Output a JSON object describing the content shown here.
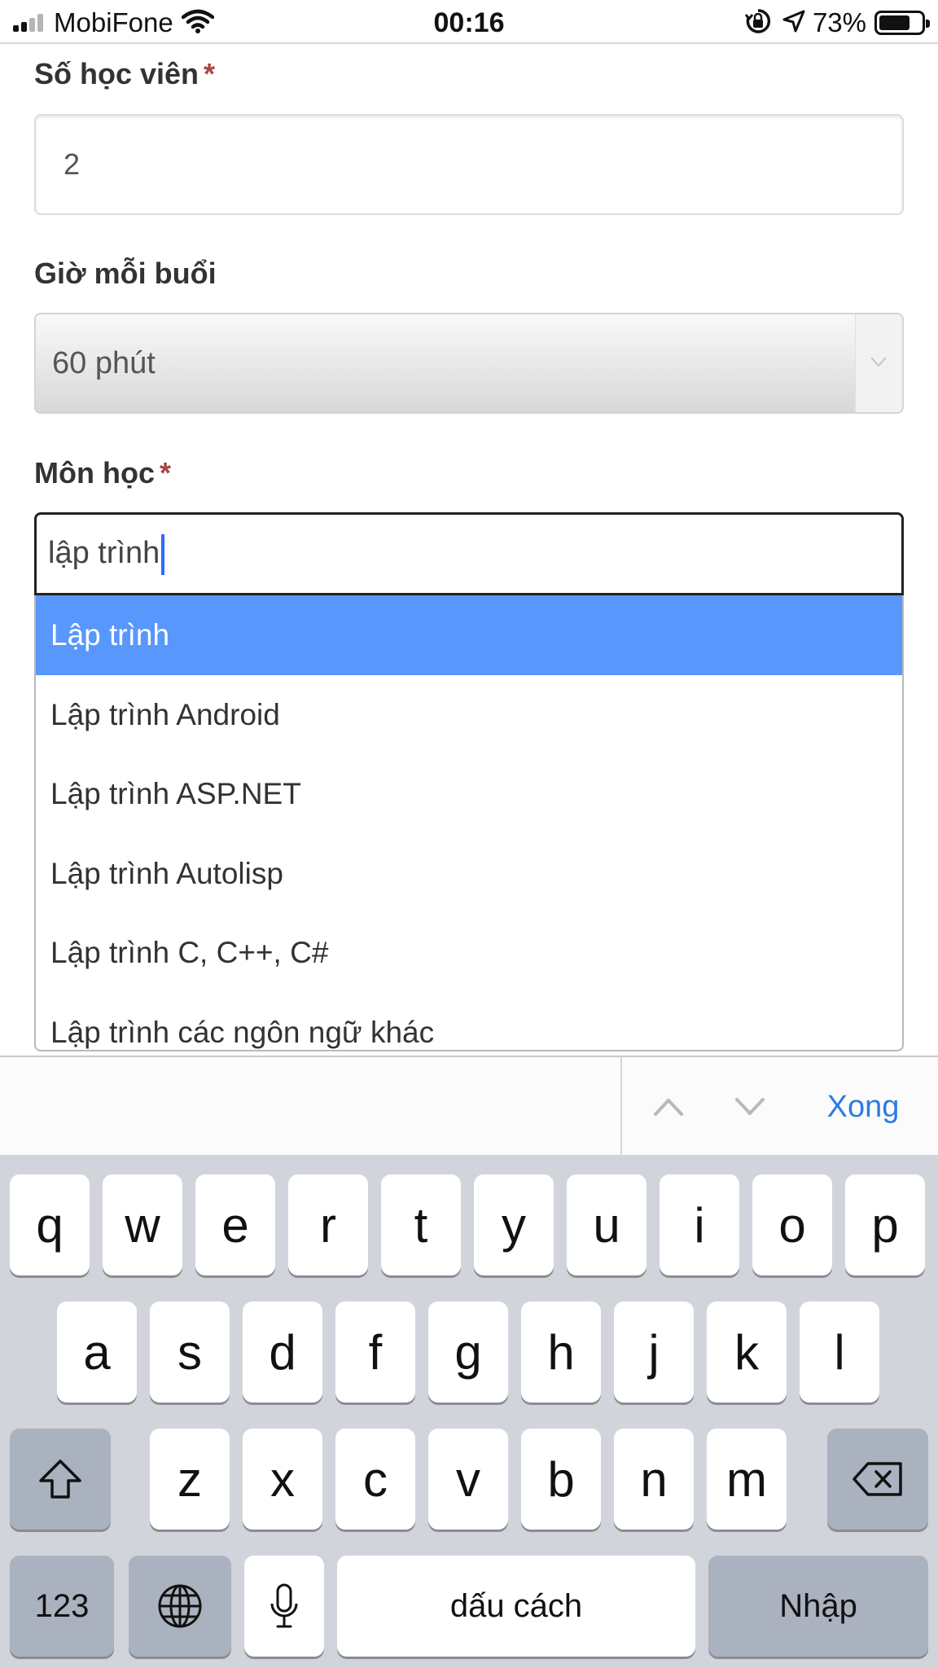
{
  "status_bar": {
    "carrier": "MobiFone",
    "time": "00:16",
    "battery_percent": "73%",
    "battery_level": 0.73,
    "icons": [
      "signal-bars-icon",
      "wifi-icon",
      "rotation-lock-icon",
      "location-arrow-icon",
      "battery-icon"
    ]
  },
  "form": {
    "students": {
      "label": "Số học viên",
      "required_mark": "*",
      "value": "2"
    },
    "session_length": {
      "label": "Giờ mỗi buổi",
      "selected": "60 phút"
    },
    "subject": {
      "label": "Môn học",
      "required_mark": "*",
      "query": "lập trình",
      "options": [
        "Lập trình",
        "Lập trình Android",
        "Lập trình ASP.NET",
        "Lập trình Autolisp",
        "Lập trình C, C++, C#",
        "Lập trình các ngôn ngữ khác"
      ],
      "highlighted_index": 0
    }
  },
  "toolbar": {
    "done_label": "Xong"
  },
  "keyboard": {
    "row1": [
      "q",
      "w",
      "e",
      "r",
      "t",
      "y",
      "u",
      "i",
      "o",
      "p"
    ],
    "row2": [
      "a",
      "s",
      "d",
      "f",
      "g",
      "h",
      "j",
      "k",
      "l"
    ],
    "row3": [
      "z",
      "x",
      "c",
      "v",
      "b",
      "n",
      "m"
    ],
    "numbers_label": "123",
    "space_label": "dấu cách",
    "return_label": "Nhập"
  },
  "colors": {
    "highlight": "#5897fb",
    "required": "#a94442",
    "done": "#2c7be5",
    "keyboard_bg": "#d1d4db"
  }
}
